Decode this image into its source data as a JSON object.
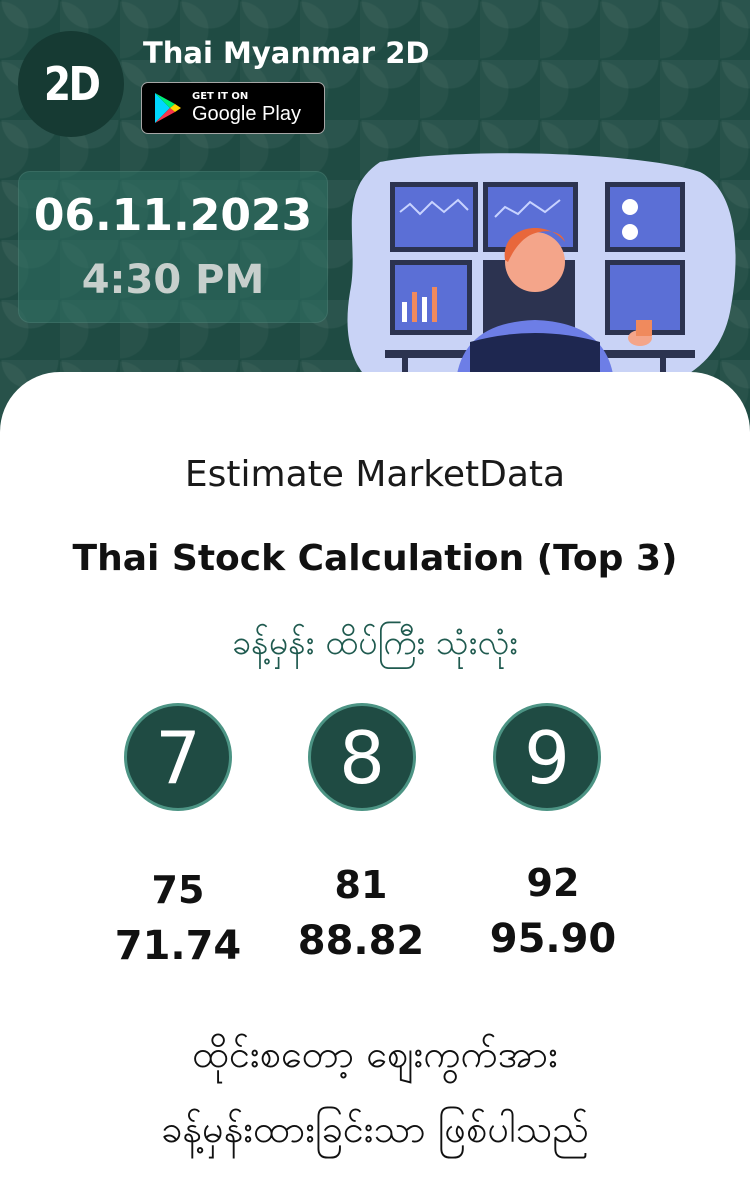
{
  "header": {
    "logo_text": "2D",
    "app_title": "Thai Myanmar 2D",
    "store_badge": {
      "small": "GET IT ON",
      "big": "Google Play"
    },
    "date": "06.11.2023",
    "time": "4:30 PM"
  },
  "card": {
    "estimate_label": "Estimate MarketData",
    "calc_title": "Thai Stock Calculation (Top 3)",
    "subtitle": "ခန့်မှန်း ထိပ်ကြီး သုံးလုံး",
    "digits": [
      {
        "digit": "7",
        "value_a": "75",
        "value_b": "71.74"
      },
      {
        "digit": "8",
        "value_a": "81",
        "value_b": "88.82"
      },
      {
        "digit": "9",
        "value_a": "92",
        "value_b": "95.90"
      }
    ],
    "footer_line1": "ထိုင်းစတော့ ဈေးကွက်အား",
    "footer_line2": "ခန့်မှန်းထားခြင်းသာ ဖြစ်ပါသည်"
  },
  "colors": {
    "brand_dark": "#1f4b43",
    "accent_teal": "#4c9484",
    "subtitle_green": "#1f5a4f"
  },
  "icons": {
    "store": "google-play-icon",
    "illustration": "trader-monitors-illustration"
  }
}
